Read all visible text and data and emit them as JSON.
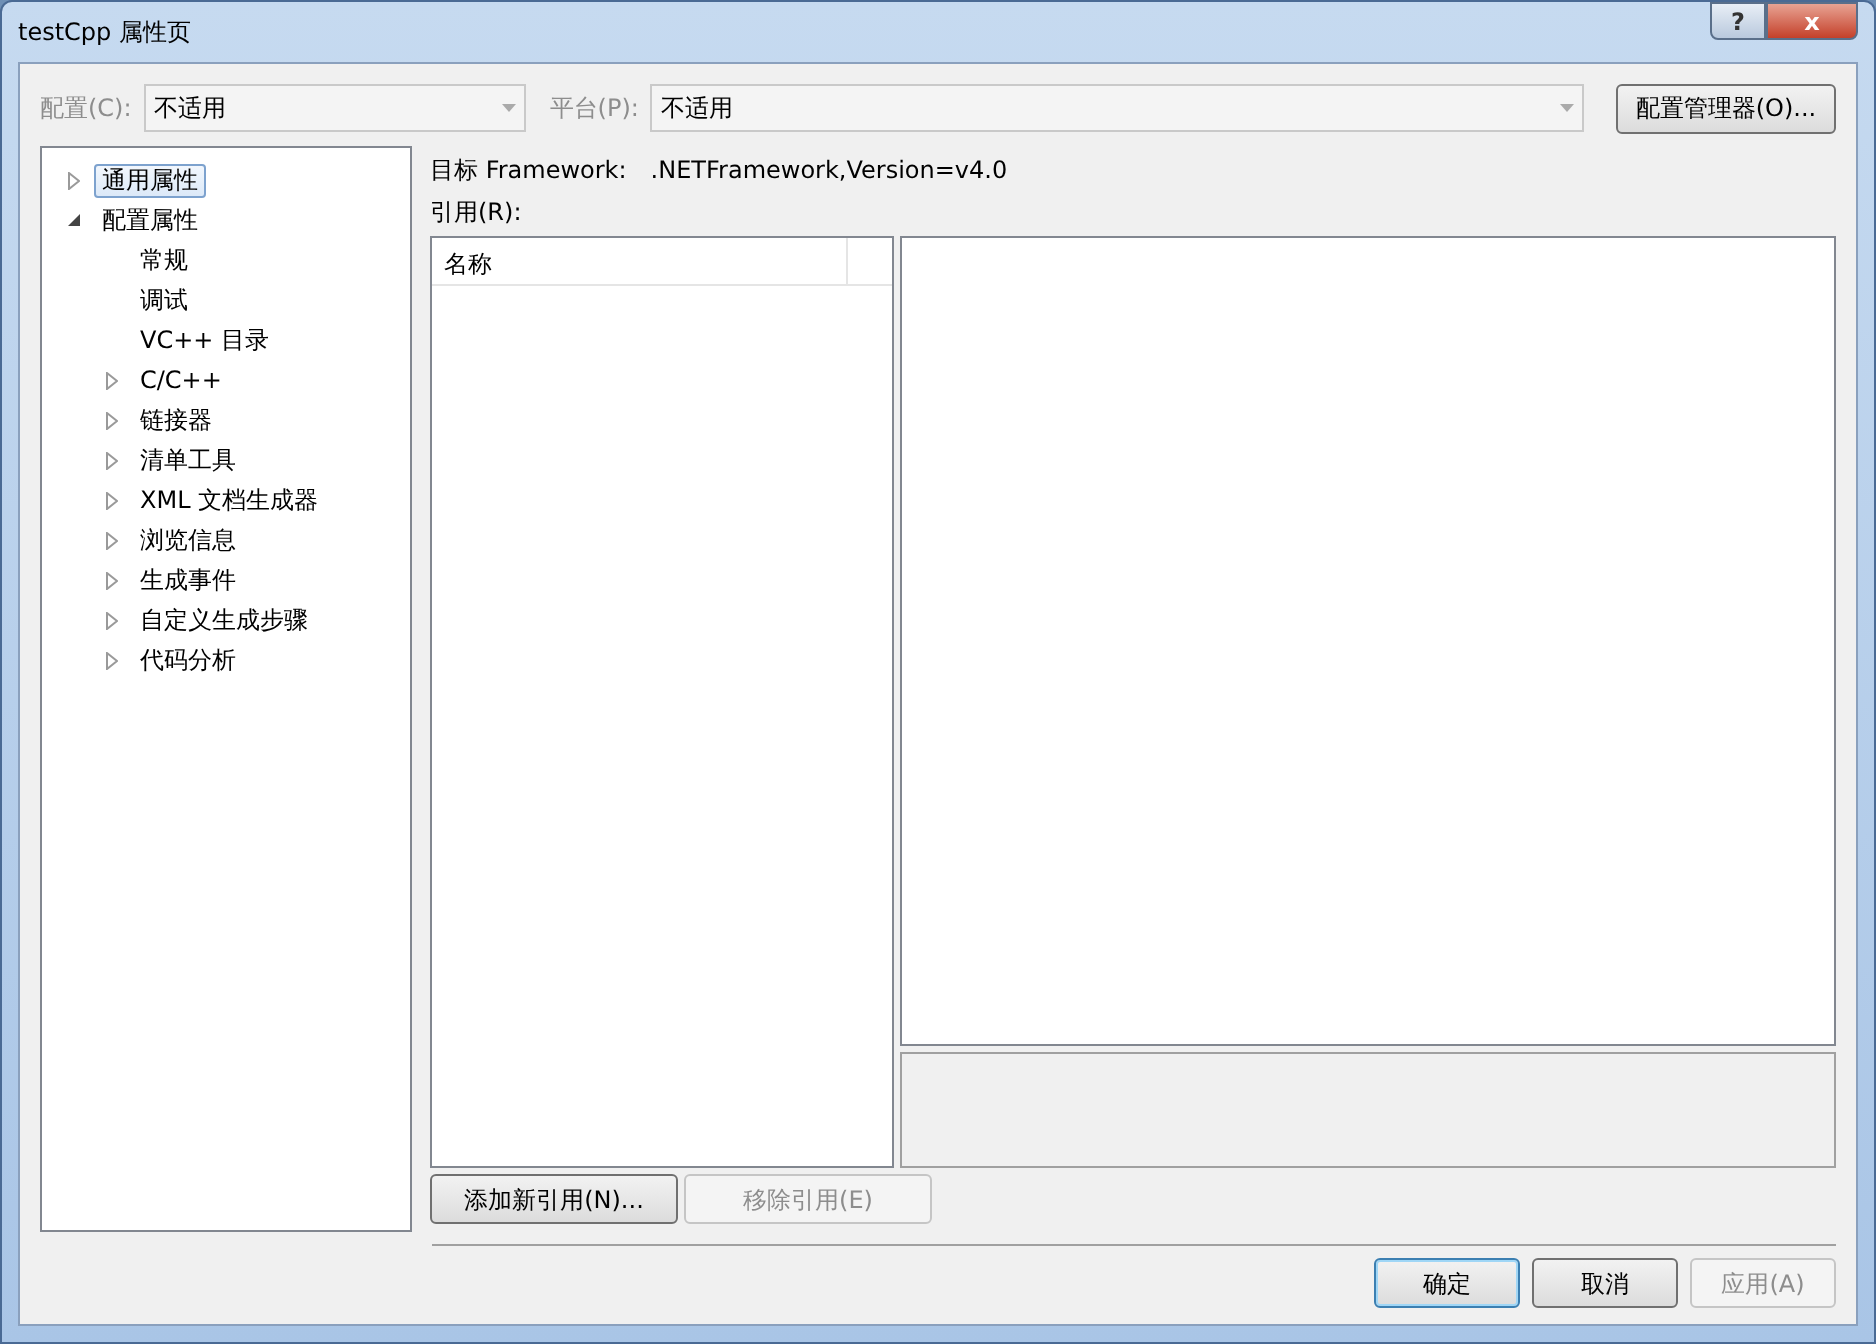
{
  "window": {
    "title": "testCpp 属性页",
    "help_button": "?",
    "close_button": "x"
  },
  "toolbar": {
    "configuration": {
      "label": "配置(C):",
      "value": "不适用",
      "disabled": true
    },
    "platform": {
      "label": "平台(P):",
      "value": "不适用",
      "disabled": true
    },
    "manager_button": {
      "label": "配置管理器(O)...",
      "disabled": false
    }
  },
  "tree": [
    {
      "label": "通用属性",
      "kind": "folder",
      "expanded": false,
      "selected": true
    },
    {
      "label": "配置属性",
      "kind": "folder",
      "expanded": true,
      "selected": false,
      "children": [
        {
          "label": "常规",
          "kind": "leaf",
          "selected": false
        },
        {
          "label": "调试",
          "kind": "leaf",
          "selected": false
        },
        {
          "label": "VC++ 目录",
          "kind": "leaf",
          "selected": false
        },
        {
          "label": "C/C++",
          "kind": "folder",
          "expanded": false,
          "selected": false
        },
        {
          "label": "链接器",
          "kind": "folder",
          "expanded": false,
          "selected": false
        },
        {
          "label": "清单工具",
          "kind": "folder",
          "expanded": false,
          "selected": false
        },
        {
          "label": "XML 文档生成器",
          "kind": "folder",
          "expanded": false,
          "selected": false
        },
        {
          "label": "浏览信息",
          "kind": "folder",
          "expanded": false,
          "selected": false
        },
        {
          "label": "生成事件",
          "kind": "folder",
          "expanded": false,
          "selected": false
        },
        {
          "label": "自定义生成步骤",
          "kind": "folder",
          "expanded": false,
          "selected": false
        },
        {
          "label": "代码分析",
          "kind": "folder",
          "expanded": false,
          "selected": false
        }
      ]
    }
  ],
  "framework": {
    "label": "目标 Framework:",
    "value": ".NETFramework,Version=v4.0"
  },
  "references": {
    "label": "引用(R):",
    "columns": [
      "名称"
    ]
  },
  "reference_buttons": [
    {
      "label": "添加新引用(N)...",
      "disabled": false
    },
    {
      "label": "移除引用(E)",
      "disabled": true
    }
  ],
  "dialog_buttons": [
    {
      "label": "确定",
      "disabled": false,
      "default": true
    },
    {
      "label": "取消",
      "disabled": false,
      "default": false
    },
    {
      "label": "应用(A)",
      "disabled": true,
      "default": false
    }
  ]
}
